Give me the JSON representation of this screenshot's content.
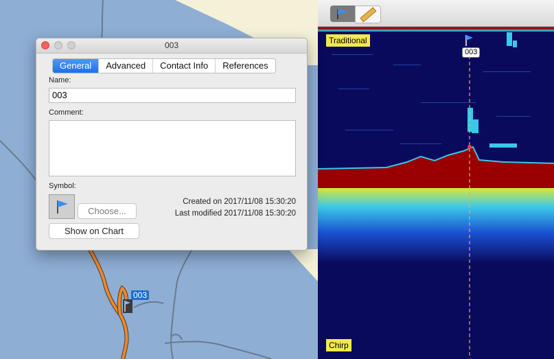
{
  "map": {
    "route_color": "#f0882a",
    "water_color": "#8eaed4",
    "land_color": "#f5f1d8",
    "waypoint_label": "003"
  },
  "sonar": {
    "toolbar": {
      "flag_tool_icon": "flag-icon",
      "ruler_tool_icon": "ruler-icon"
    },
    "top_label": "Traditional",
    "bottom_label": "Chirp",
    "marker_label": "003",
    "background_color": "#0a0a5c",
    "bottom_return_color": "#9b0000"
  },
  "dialog": {
    "title": "003",
    "tabs": [
      {
        "label": "General",
        "active": true
      },
      {
        "label": "Advanced",
        "active": false
      },
      {
        "label": "Contact Info",
        "active": false
      },
      {
        "label": "References",
        "active": false
      }
    ],
    "name_label": "Name:",
    "name_value": "003",
    "comment_label": "Comment:",
    "comment_value": "",
    "symbol_label": "Symbol:",
    "symbol_icon": "flag-icon",
    "choose_button": "Choose...",
    "show_on_chart_button": "Show on Chart",
    "created": "Created on 2017/11/08 15:30:20",
    "modified": "Last modified 2017/11/08 15:30:20"
  }
}
